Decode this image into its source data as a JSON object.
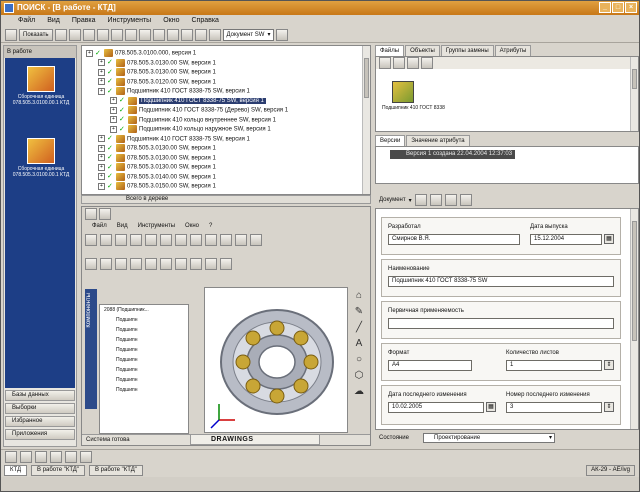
{
  "window": {
    "title": "ПОИСК - [В работе - КТД]"
  },
  "menu": [
    "Файл",
    "Вид",
    "Правка",
    "Инструменты",
    "Окно",
    "Справка"
  ],
  "toolbar": {
    "show_label": "Показать",
    "document_select": "Документ SW"
  },
  "left_panel": {
    "header": "В работе",
    "items": [
      {
        "label": "Сборочная единица 078.505.3.0100.00.1 КТД"
      },
      {
        "label": "Сборочная единица 078.505.3.0100.00.1 КТД"
      }
    ],
    "nav": [
      "Базы данных",
      "Выборки",
      "Избранное",
      "Приложения"
    ]
  },
  "tree": {
    "rows": [
      {
        "text": "078.505.3.0100.000, версия 1",
        "depth": 0
      },
      {
        "text": "078.505.3.0130.00 SW, версия 1",
        "depth": 1
      },
      {
        "text": "078.505.3.0130.00 SW, версия 1",
        "depth": 1
      },
      {
        "text": "078.505.3.0120.00 SW, версия 1",
        "depth": 1
      },
      {
        "text": "Подшипник 410 ГОСТ 8338-75 SW, версия 1",
        "depth": 1
      },
      {
        "text": "Подшипник 410 ГОСТ 8338-75 SW, версия 1",
        "depth": 2,
        "highlight": true
      },
      {
        "text": "Подшипник 410 ГОСТ 8338-75 (Дерево) SW, версия 1",
        "depth": 2
      },
      {
        "text": "Подшипник 410 кольцо внутреннее SW, версия 1",
        "depth": 2
      },
      {
        "text": "Подшипник 410 кольцо наружное SW, версия 1",
        "depth": 2
      },
      {
        "text": "Подшипник 410 ГОСТ 8338-75 SW, версия 1",
        "depth": 1
      },
      {
        "text": "078.505.3.0130.00 SW, версия 1",
        "depth": 1
      },
      {
        "text": "078.505.3.0130.00 SW, версия 1",
        "depth": 1
      },
      {
        "text": "078.505.3.0130.00 SW, версия 1",
        "depth": 1
      },
      {
        "text": "078.505.3.0140.00 SW, версия 1",
        "depth": 1
      },
      {
        "text": "078.505.3.0150.00 SW, версия 1",
        "depth": 1
      }
    ],
    "footer": "Всего в дереве"
  },
  "inner_app": {
    "menu": [
      "Файл",
      "Вид",
      "Инструменты",
      "Окно",
      "?"
    ],
    "tab_label": "Компоненты",
    "feature_tree": {
      "root": "2088 (Подшипник...",
      "items": [
        "Подшипн",
        "Подшипн",
        "Подшипн",
        "Подшипн",
        "Подшипн",
        "Подшипн",
        "Подшипн",
        "Подшипн"
      ]
    },
    "status": "Система готова",
    "drawings_label": "DRAWINGS"
  },
  "right_panel": {
    "top_tabs": [
      "Файлы",
      "Объекты",
      "Группы замены",
      "Атрибуты"
    ],
    "file_label": "Подшипник 410 ГОСТ 8338",
    "version_tabs": [
      "Версии",
      "Значение атрибута"
    ],
    "version_row": "Версия 1 создана 22.04.2004 12:37:03",
    "doc_toolbar_label": "Документ",
    "form": {
      "developer_label": "Разработал",
      "developer_value": "Смирнов В.Я.",
      "release_date_label": "Дата выпуска",
      "release_date_value": "15.12.2004",
      "name_label": "Наименование",
      "name_value": "Подшипник 410 ГОСТ 8338-75 SW",
      "first_use_label": "Первичная применяемость",
      "first_use_value": "",
      "format_label": "Формат",
      "format_value": "А4",
      "sheets_label": "Количество листов",
      "sheets_value": "1",
      "last_change_date_label": "Дата последнего изменения",
      "last_change_date_value": "10.02.2005",
      "last_change_num_label": "Номер последнего изменения",
      "last_change_num_value": "3"
    },
    "state_label": "Состояние",
    "state_value": "Проектирование"
  },
  "statusbar": {
    "tabs": [
      "КТД",
      "В работе \"КТД\"",
      "В работе \"КТД\""
    ],
    "right": "АК-29 - АЕ/ivg"
  }
}
